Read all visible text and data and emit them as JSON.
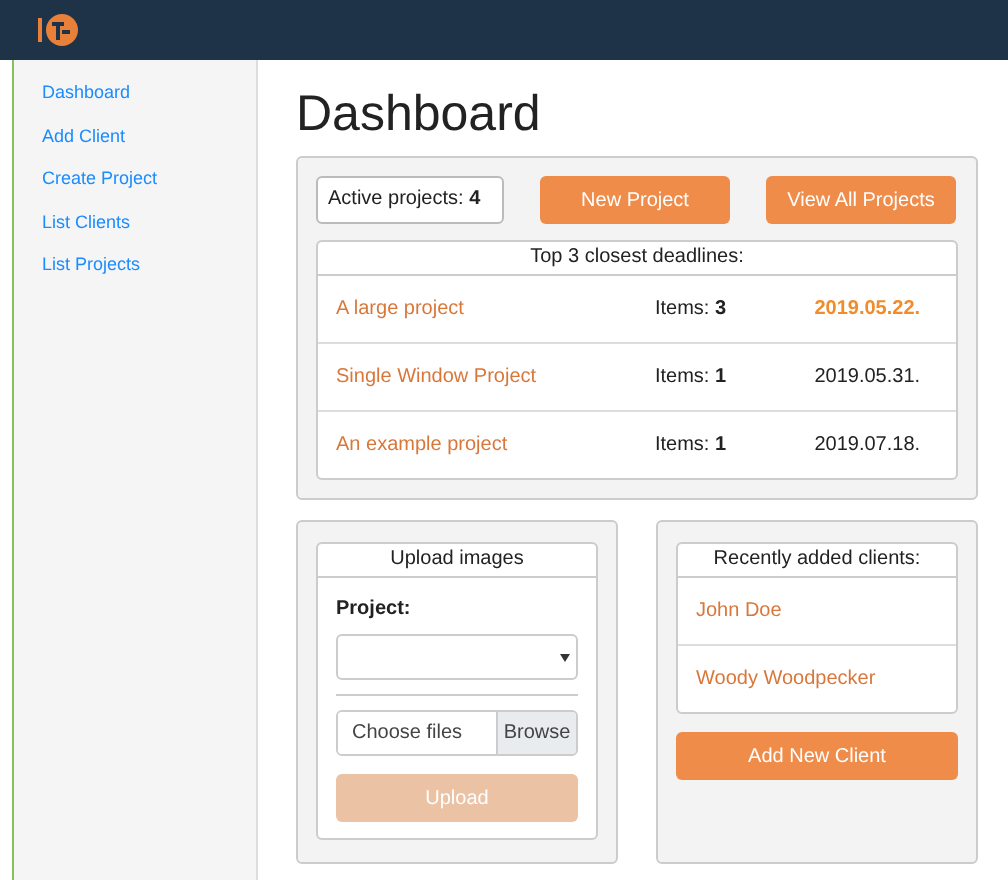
{
  "sidebar": {
    "items": [
      {
        "label": "Dashboard"
      },
      {
        "label": "Add Client"
      },
      {
        "label": "Create Project"
      },
      {
        "label": "List Clients"
      },
      {
        "label": "List Projects"
      }
    ]
  },
  "page_title": "Dashboard",
  "summary": {
    "label": "Active projects: ",
    "count": "4"
  },
  "buttons": [
    "New Project",
    "View All Projects"
  ],
  "deadlines": {
    "title": "Top 3 closest deadlines:",
    "rows": [
      {
        "name": "A large project",
        "items_label": "Items: ",
        "items": "3",
        "date": "2019.05.22.",
        "urgent": true
      },
      {
        "name": "Single Window Project",
        "items_label": "Items: ",
        "items": "1",
        "date": "2019.05.31.",
        "urgent": false
      },
      {
        "name": "An example project",
        "items_label": "Items: ",
        "items": "1",
        "date": "2019.07.18.",
        "urgent": false
      }
    ]
  },
  "upload": {
    "title": "Upload images",
    "project_label": "Project:",
    "file_placeholder": "Choose files",
    "browse": "Browse",
    "button": "Upload",
    "disabled": true
  },
  "clients": {
    "title": "Recently added clients:",
    "items": [
      "John Doe",
      "Woody Woodpecker"
    ],
    "button": "Add New Client"
  }
}
